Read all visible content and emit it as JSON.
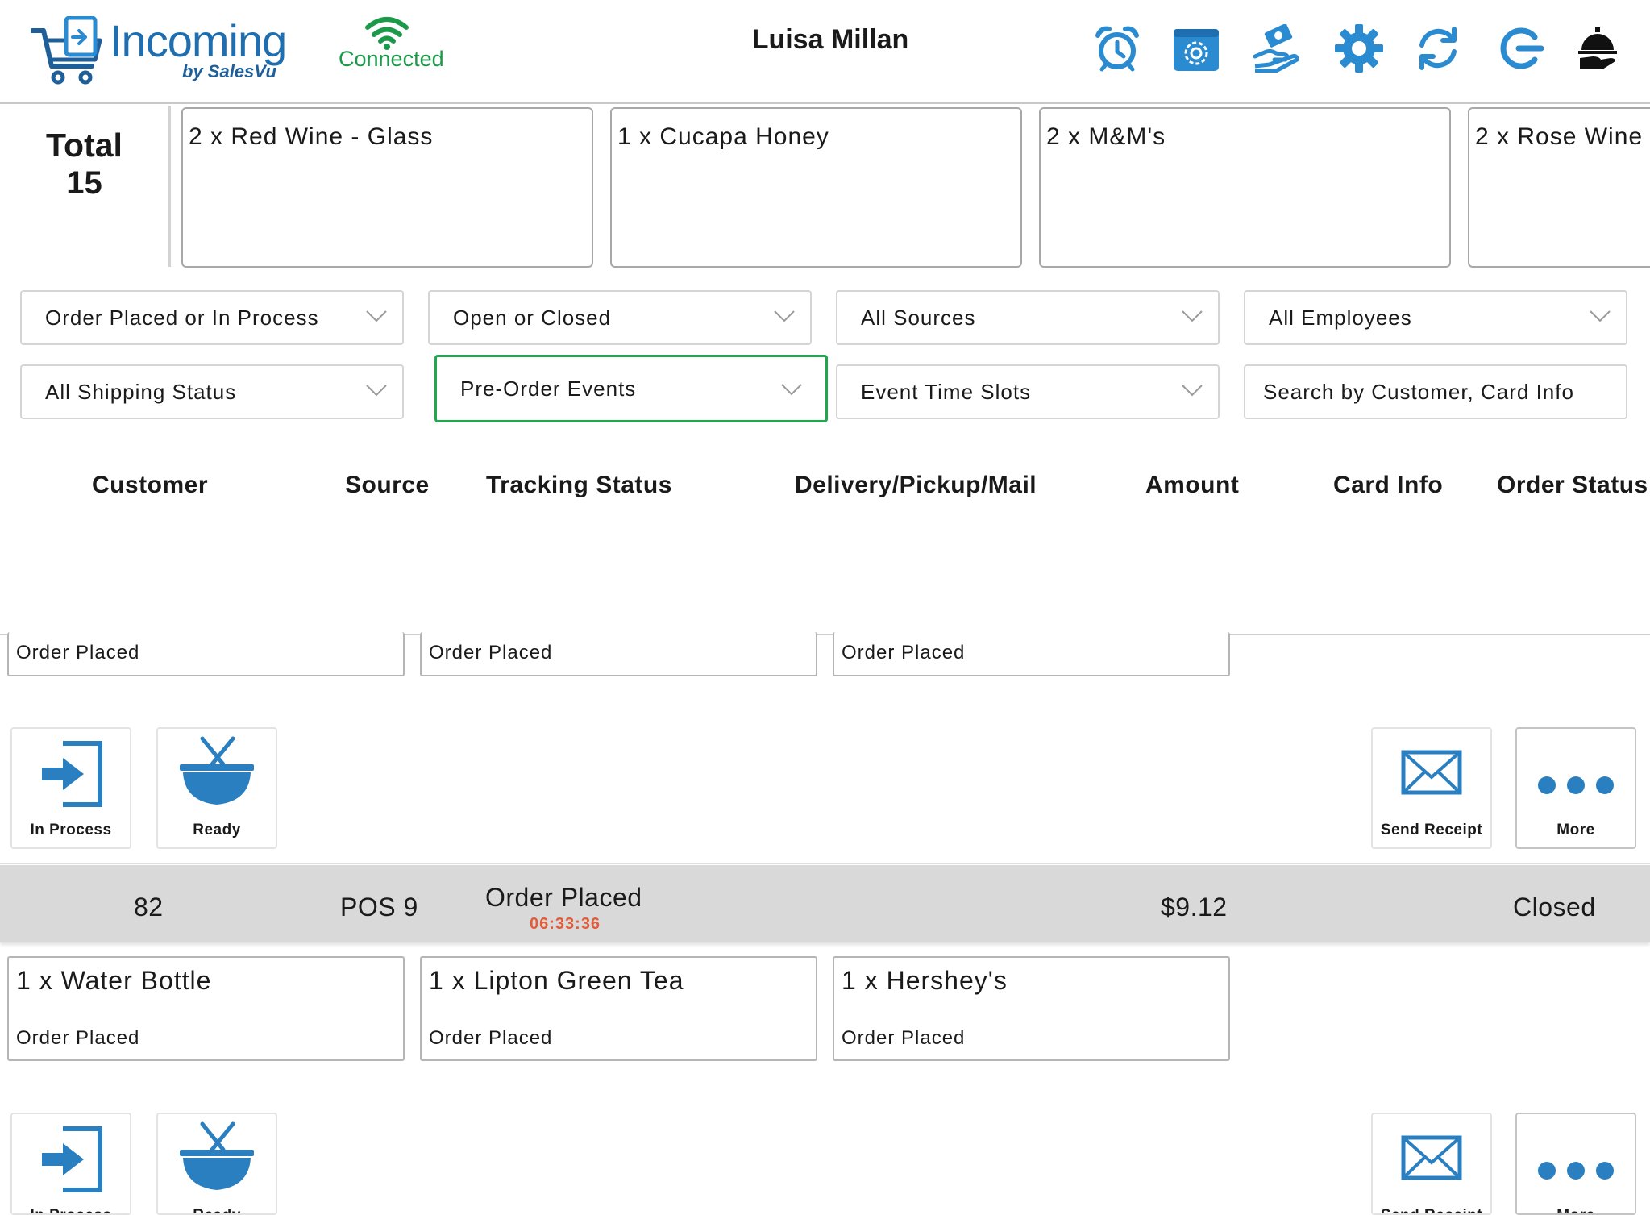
{
  "header": {
    "app_name": "Incoming",
    "app_sub": "by SalesVu",
    "connection": "Connected",
    "user_name": "Luisa Millan",
    "icons": [
      "alarm-clock-icon",
      "settings-box-icon",
      "cash-hand-icon",
      "gear-icon",
      "refresh-icon",
      "logout-icon",
      "service-bell-icon"
    ],
    "colors": {
      "brand_blue": "#1f6eaf",
      "connected_green": "#1c9a4a",
      "icon_blue": "#2a8bd1"
    }
  },
  "totals": {
    "label": "Total",
    "count": "15",
    "items": [
      "2 x Red Wine - Glass",
      "1 x Cucapa Honey",
      "2 x M&M's",
      "2 x Rose Wine"
    ]
  },
  "filters": {
    "order_state": "Order Placed or In Process",
    "open_closed": "Open or Closed",
    "sources": "All Sources",
    "employees": "All Employees",
    "shipping": "All Shipping Status",
    "pre_order": "Pre-Order Events",
    "time_slots": "Event Time Slots",
    "search_placeholder": "Search by Customer, Card Info",
    "active_color": "#20a84e"
  },
  "columns": [
    "Customer",
    "Source",
    "Tracking Status",
    "Delivery/Pickup/Mail",
    "Amount",
    "Card Info",
    "Order Status"
  ],
  "order_prev": {
    "items": [
      {
        "status": "Order Placed"
      },
      {
        "status": "Order Placed"
      },
      {
        "status": "Order Placed"
      }
    ],
    "actions": {
      "in_process": "In Process",
      "ready": "Ready",
      "send_receipt": "Send Receipt",
      "more": "More"
    }
  },
  "order_82": {
    "customer": "82",
    "source": "POS 9",
    "tracking_status": "Order Placed",
    "timer": "06:33:36",
    "amount": "$9.12",
    "order_status": "Closed",
    "items": [
      {
        "name": "1 x Water Bottle",
        "status": "Order Placed"
      },
      {
        "name": "1 x Lipton Green Tea",
        "status": "Order Placed"
      },
      {
        "name": "1 x Hershey's",
        "status": "Order Placed"
      }
    ],
    "actions": {
      "in_process": "In Process",
      "ready": "Ready",
      "send_receipt": "Send Receipt",
      "more": "More"
    }
  }
}
